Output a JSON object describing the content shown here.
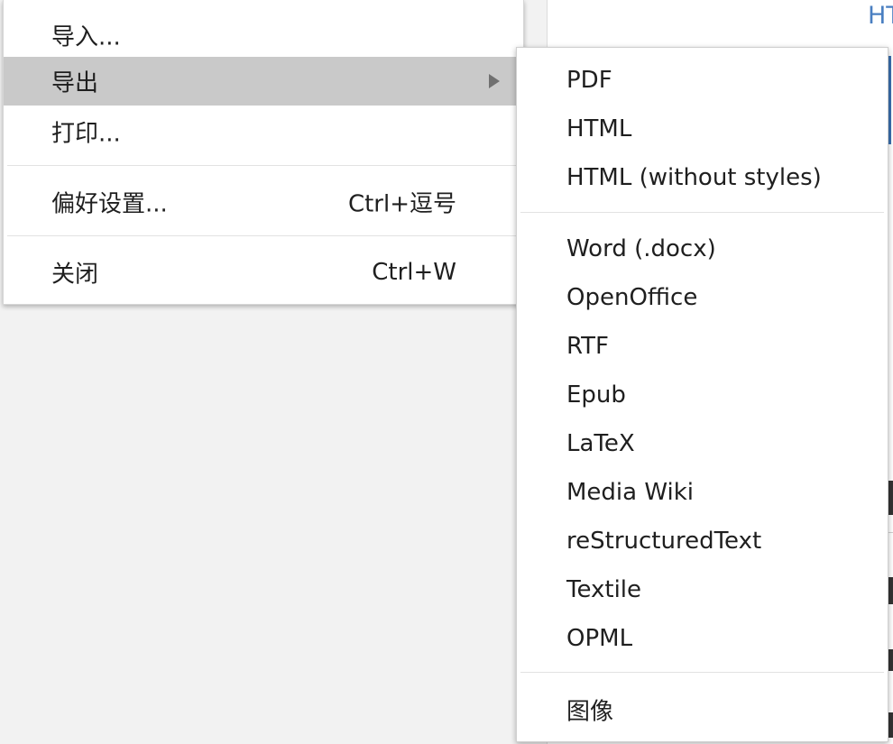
{
  "background": {
    "link_text": "HT"
  },
  "main_menu": {
    "items": [
      {
        "label": "导入...",
        "shortcut": ""
      },
      {
        "label": "导出",
        "shortcut": "",
        "has_submenu": true
      },
      {
        "label": "打印...",
        "shortcut": ""
      },
      {
        "label": "偏好设置...",
        "shortcut": "Ctrl+逗号"
      },
      {
        "label": "关闭",
        "shortcut": "Ctrl+W"
      }
    ]
  },
  "export_submenu": {
    "items": [
      {
        "label": "PDF"
      },
      {
        "label": "HTML"
      },
      {
        "label": "HTML (without styles)"
      },
      {
        "label": "Word (.docx)"
      },
      {
        "label": "OpenOffice"
      },
      {
        "label": "RTF"
      },
      {
        "label": "Epub"
      },
      {
        "label": "LaTeX"
      },
      {
        "label": "Media Wiki"
      },
      {
        "label": "reStructuredText"
      },
      {
        "label": "Textile"
      },
      {
        "label": "OPML"
      },
      {
        "label": "图像"
      }
    ]
  },
  "colors": {
    "hover": "#c9c9c9",
    "link": "#4a7fc1"
  }
}
